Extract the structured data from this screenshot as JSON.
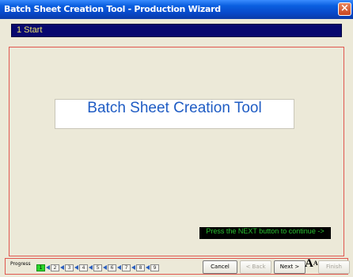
{
  "window": {
    "title": "Batch Sheet Creation Tool - Production Wizard",
    "close_glyph": "×"
  },
  "step_header": {
    "label": "1 Start"
  },
  "main": {
    "hero_title": "Batch Sheet Creation Tool",
    "hint": "Press the NEXT button to continue ->"
  },
  "progress": {
    "label": "Progress",
    "current": 1,
    "steps": [
      "1",
      "2",
      "3",
      "4",
      "5",
      "6",
      "7",
      "8",
      "9"
    ]
  },
  "buttons": {
    "cancel": "Cancel",
    "back": "< Back",
    "next": "Next >",
    "finish": "Finish"
  },
  "icons": {
    "font_icon": "A"
  },
  "colors": {
    "step_bar": "#07086f",
    "step_text": "#e8e06a",
    "hero_text": "#1f5cc4",
    "hint_text": "#29c231",
    "progress_active": "#2bd62b",
    "panel_border": "#e0574f"
  }
}
